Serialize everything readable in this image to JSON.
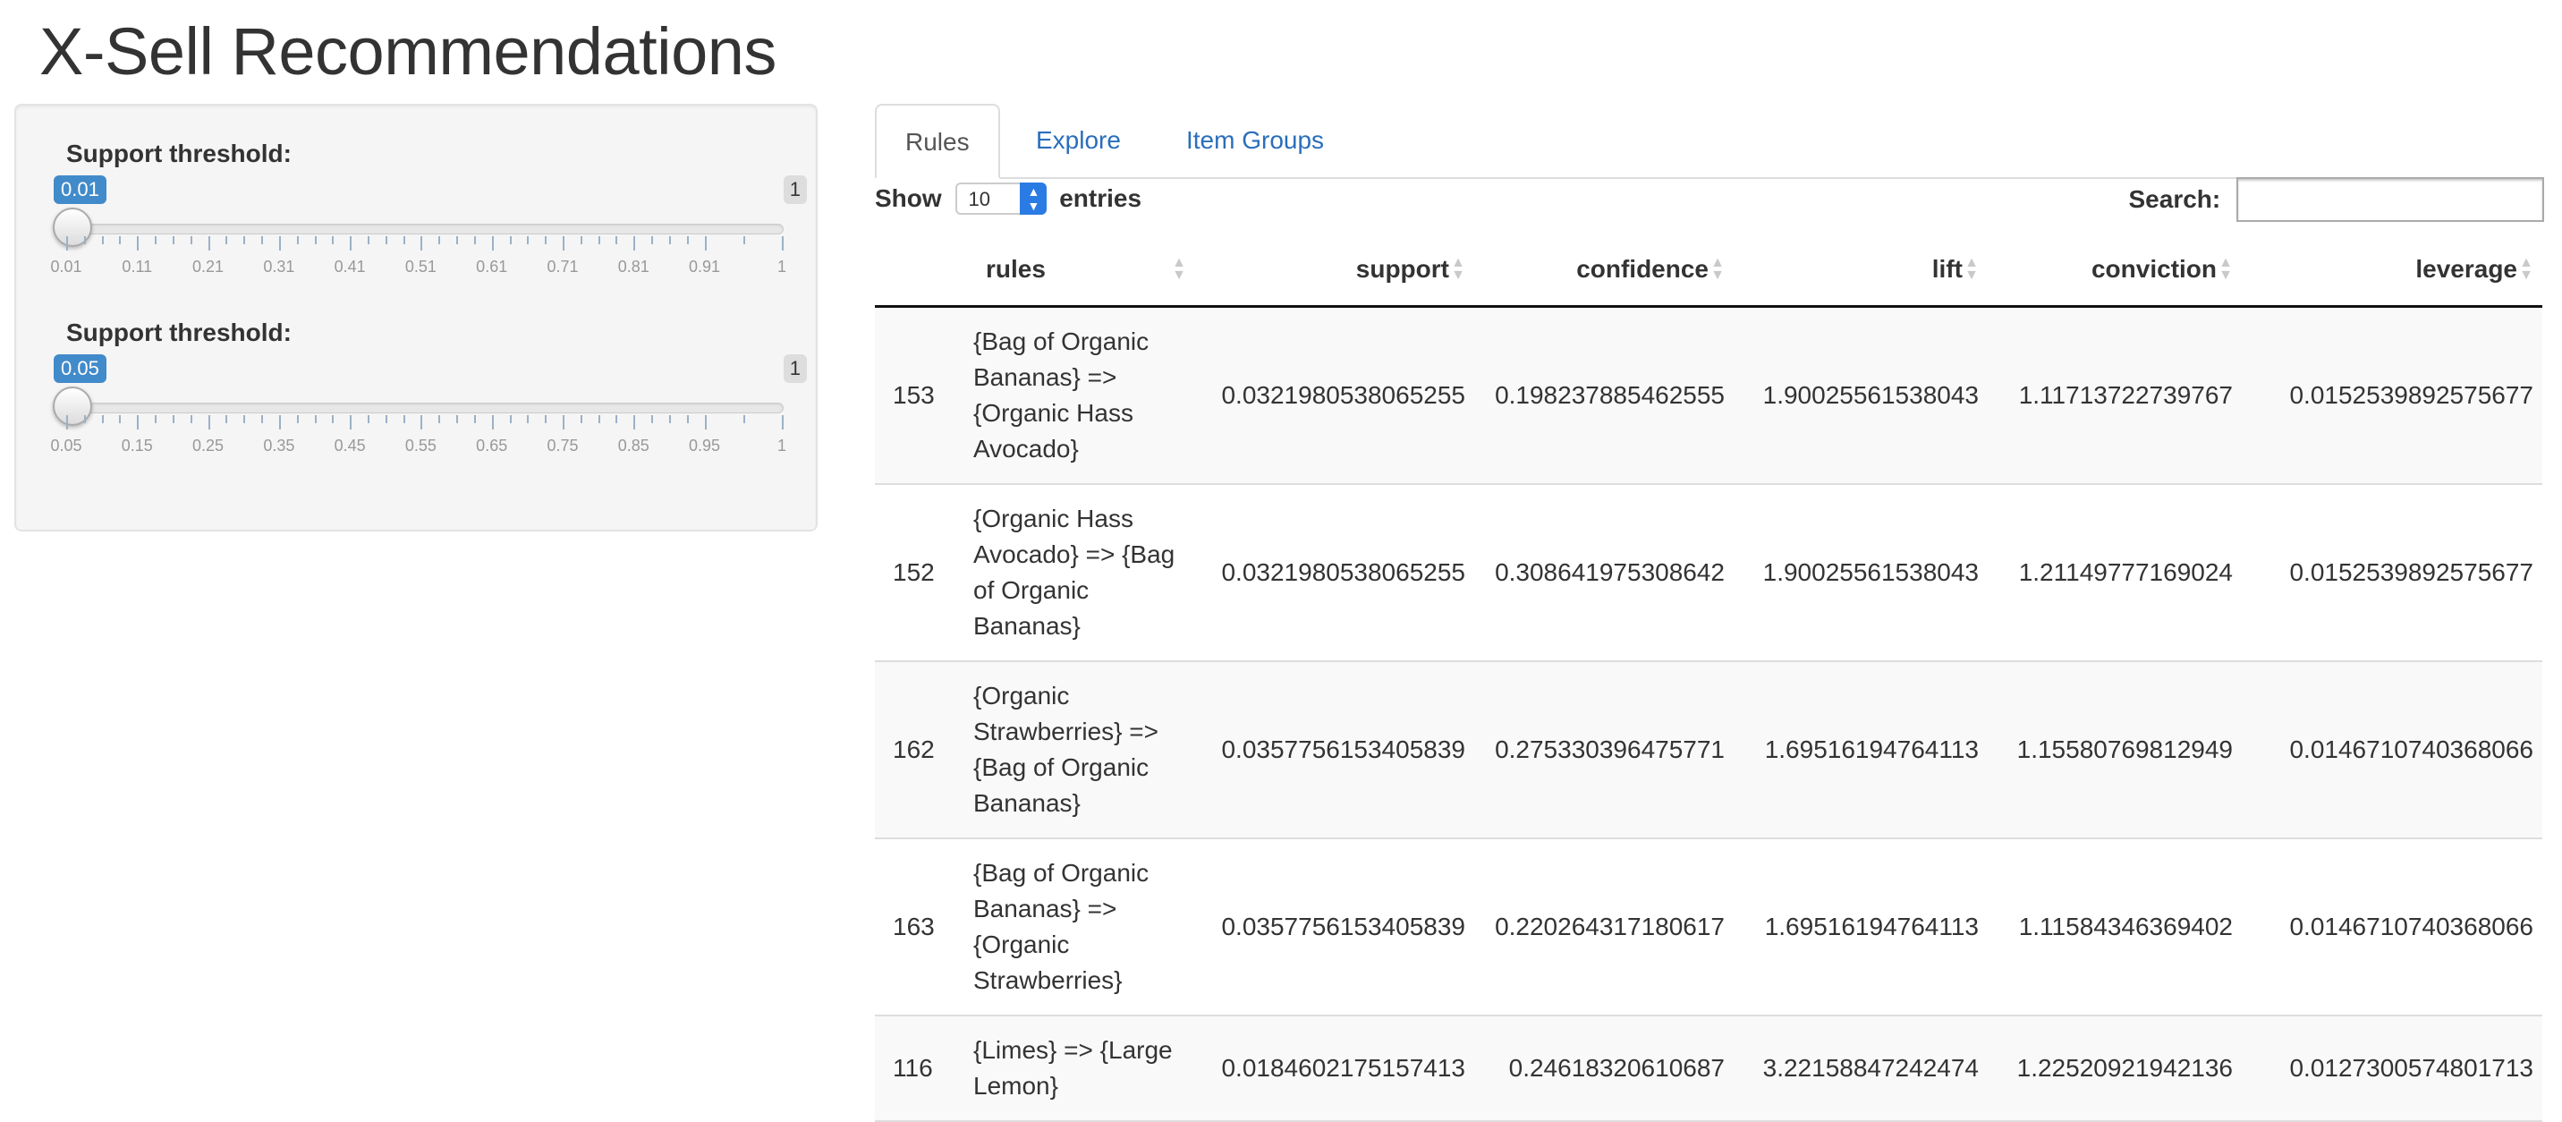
{
  "title": "X-Sell Recommendations",
  "sidebar": {
    "sliders": [
      {
        "label": "Support threshold:",
        "value": "0.01",
        "max_label": "1",
        "ticks": [
          "0.01",
          "0.11",
          "0.21",
          "0.31",
          "0.41",
          "0.51",
          "0.61",
          "0.71",
          "0.81",
          "0.91",
          "1"
        ]
      },
      {
        "label": "Support threshold:",
        "value": "0.05",
        "max_label": "1",
        "ticks": [
          "0.05",
          "0.15",
          "0.25",
          "0.35",
          "0.45",
          "0.55",
          "0.65",
          "0.75",
          "0.85",
          "0.95",
          "1"
        ]
      }
    ]
  },
  "tabs": [
    {
      "label": "Rules",
      "active": true
    },
    {
      "label": "Explore",
      "active": false
    },
    {
      "label": "Item Groups",
      "active": false
    }
  ],
  "table_controls": {
    "show_label": "Show",
    "entries_value": "10",
    "entries_label": "entries",
    "search_label": "Search:",
    "search_value": ""
  },
  "table": {
    "columns": [
      "",
      "rules",
      "support",
      "confidence",
      "lift",
      "conviction",
      "leverage"
    ],
    "rows": [
      [
        "153",
        "{Bag of Organic Bananas} => {Organic Hass Avocado}",
        "0.0321980538065255",
        "0.198237885462555",
        "1.90025561538043",
        "1.11713722739767",
        "0.0152539892575677"
      ],
      [
        "152",
        "{Organic Hass Avocado} => {Bag of Organic Bananas}",
        "0.0321980538065255",
        "0.308641975308642",
        "1.90025561538043",
        "1.21149777169024",
        "0.0152539892575677"
      ],
      [
        "162",
        "{Organic Strawberries} => {Bag of Organic Bananas}",
        "0.0357756153405839",
        "0.275330396475771",
        "1.69516194764113",
        "1.15580769812949",
        "0.0146710740368066"
      ],
      [
        "163",
        "{Bag of Organic Bananas} => {Organic Strawberries}",
        "0.0357756153405839",
        "0.220264317180617",
        "1.69516194764113",
        "1.11584346369402",
        "0.0146710740368066"
      ],
      [
        "116",
        "{Limes} => {Large Lemon}",
        "0.0184602175157413",
        "0.24618320610687",
        "3.22158847242474",
        "1.22520921942136",
        "0.0127300574801713"
      ]
    ]
  }
}
